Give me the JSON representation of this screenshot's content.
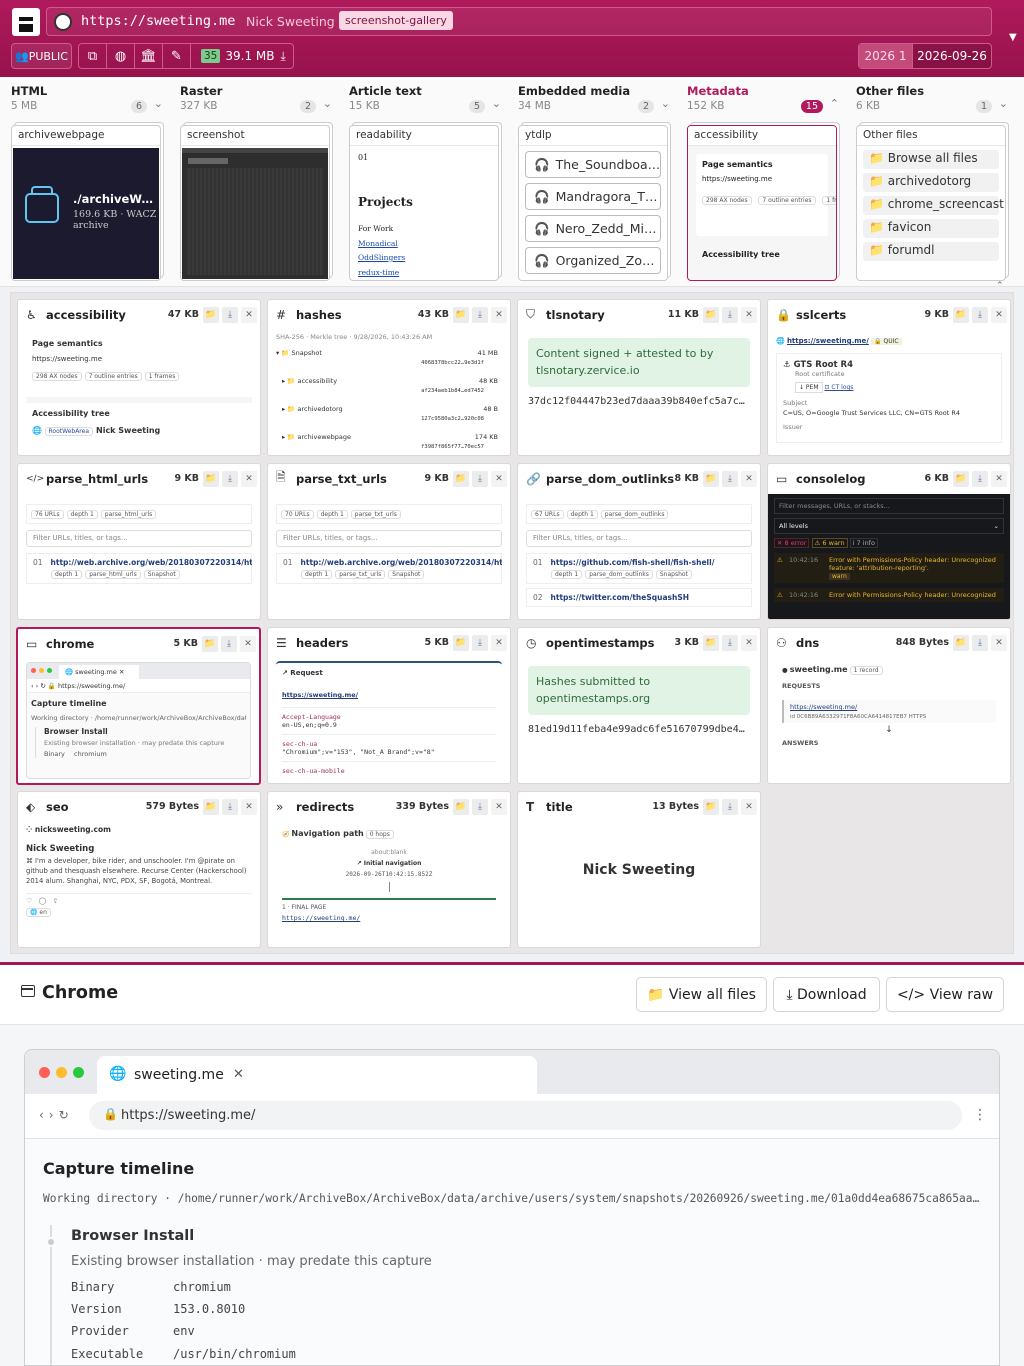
{
  "header": {
    "url": "https://sweeting.me",
    "title": "Nick Sweeting",
    "tag": "screenshot-gallery",
    "public_label": "👥PUBLIC",
    "result_count": "35",
    "total_size": "39.1 MB",
    "date_left": "2026 1",
    "date_right": "2026-09-26"
  },
  "categories": [
    {
      "title": "HTML",
      "size": "5 MB",
      "count": "6",
      "card_label": "archivewebpage",
      "card_text": "./archiveWebpage",
      "card_sub": "169.6 KB · WACZ",
      "card_sub2": "archive"
    },
    {
      "title": "Raster",
      "size": "327 KB",
      "count": "2",
      "card_label": "screenshot"
    },
    {
      "title": "Article text",
      "size": "15 KB",
      "count": "5",
      "card_label": "readability",
      "num": "01",
      "heading": "Projects",
      "sub": "For Work",
      "links": [
        "Monadical",
        "OddSlingers",
        "redux-time"
      ]
    },
    {
      "title": "Embedded media",
      "size": "34 MB",
      "count": "2",
      "card_label": "ytdlp",
      "items": [
        "The_Soundboa…",
        "Mandragora_T…",
        "Nero_Zedd_Mi…",
        "Organized_Zo…"
      ]
    },
    {
      "title": "Metadata",
      "size": "152 KB",
      "count": "15",
      "card_label": "accessibility",
      "sec1": "Page semantics",
      "url": "https://sweeting.me",
      "chip1": "298 AX nodes",
      "chip2": "7 outline entries",
      "chip3": "1 frames",
      "sec2": "Accessibility tree"
    },
    {
      "title": "Other files",
      "size": "6 KB",
      "count": "1",
      "card_label": "Other files",
      "items": [
        "Browse all files",
        "archivedotorg",
        "chrome_screencast",
        "favicon",
        "forumdl"
      ]
    }
  ],
  "cards": [
    {
      "name": "accessibility",
      "size": "47 KB",
      "icon": "♿"
    },
    {
      "name": "hashes",
      "size": "43 KB",
      "icon": "#"
    },
    {
      "name": "tlsnotary",
      "size": "11 KB",
      "icon": "⛉"
    },
    {
      "name": "sslcerts",
      "size": "9 KB",
      "icon": "🔒"
    },
    {
      "name": "parse_html_urls",
      "size": "9 KB",
      "icon": "</>"
    },
    {
      "name": "parse_txt_urls",
      "size": "9 KB",
      "icon": "🗎"
    },
    {
      "name": "parse_dom_outlinks",
      "size": "8 KB",
      "icon": "🔗"
    },
    {
      "name": "consolelog",
      "size": "6 KB",
      "icon": "▭"
    },
    {
      "name": "chrome",
      "size": "5 KB",
      "icon": "▭"
    },
    {
      "name": "headers",
      "size": "5 KB",
      "icon": "☰"
    },
    {
      "name": "opentimestamps",
      "size": "3 KB",
      "icon": "◷"
    },
    {
      "name": "dns",
      "size": "848 Bytes",
      "icon": "⚇"
    },
    {
      "name": "seo",
      "size": "579 Bytes",
      "icon": "⬖"
    },
    {
      "name": "redirects",
      "size": "339 Bytes",
      "icon": "»"
    },
    {
      "name": "title",
      "size": "13 Bytes",
      "icon": "T"
    }
  ],
  "card_content": {
    "accessibility": {
      "sec1": "Page semantics",
      "url": "https://sweeting.me",
      "chip1": "298 AX nodes",
      "chip2": "7 outline entries",
      "chip3": "1 frames",
      "sec2": "Accessibility tree",
      "role": "RootWebArea",
      "name": "Nick Sweeting"
    },
    "hashes": {
      "meta": "SHA-256 · Merkle tree · 9/28/2026, 10:43:26 AM",
      "rows": [
        {
          "name": "Snapshot",
          "size": "41 MB",
          "hash": "4068378bcc22…9e3d1f"
        },
        {
          "name": "accessibility",
          "size": "48 KB",
          "hash": "af234aeb1b84…ed7452"
        },
        {
          "name": "archivedotorg",
          "size": "48 B",
          "hash": "127c9580a3c2…920c08"
        },
        {
          "name": "archivewebpage",
          "size": "174 KB",
          "hash": "f3987f865f77…70ec57"
        }
      ]
    },
    "tlsnotary": {
      "text": "Content signed + attested to by tlsnotary.zervice.io",
      "hash": "37dc12f04447b23ed7daaa39b840efc5a7c…"
    },
    "sslcerts": {
      "host": "https://sweeting.me/",
      "proto": "QUIC",
      "cert": "GTS Root R4",
      "certsub": "Root certificate",
      "pem": "↓ PEM",
      "ctlogs": "CT logs",
      "subj_label": "Subject",
      "subject": "C=US, O=Google Trust Services LLC, CN=GTS Root R4",
      "issuer": "Issuer"
    },
    "parse_html_urls": {
      "chips": [
        "76 URLs",
        "depth 1",
        "parse_html_urls"
      ],
      "filter": "Filter URLs, titles, or tags...",
      "num": "01",
      "link": "http://web.archive.org/web/20180307220314/https://freevpn.club/",
      "tags": [
        "depth 1",
        "parse_html_urls",
        "Snapshot"
      ]
    },
    "parse_txt_urls": {
      "chips": [
        "70 URLs",
        "depth 1",
        "parse_txt_urls"
      ],
      "filter": "Filter URLs, titles, or tags...",
      "num": "01",
      "link": "http://web.archive.org/web/20180307220314/https://freevpn.club/",
      "tags": [
        "depth 1",
        "parse_txt_urls",
        "Snapshot"
      ]
    },
    "parse_dom_outlinks": {
      "chips": [
        "67 URLs",
        "depth 1",
        "parse_dom_outlinks"
      ],
      "filter": "Filter URLs, titles, or tags...",
      "num": "01",
      "link": "https://github.com/fish-shell/fish-shell/",
      "tags": [
        "depth 1",
        "parse_dom_outlinks",
        "Snapshot"
      ],
      "num2": "02",
      "link2": "https://twitter.com/theSquashSH"
    },
    "consolelog": {
      "filter": "Filter messages, URLs, or stacks...",
      "levels": "All levels",
      "c_err": "✕ 8 error",
      "c_warn": "⚠ 6 warn",
      "c_info": "i 7 info",
      "time": "10:42:16",
      "msg": "Error with Permissions-Policy header: Unrecognized feature: 'attribution-reporting'.",
      "lvl": "warn",
      "msg2": "Error with Permissions-Policy header: Unrecognized"
    },
    "chrome": {
      "tab": "sweeting.me",
      "url": "https://sweeting.me/",
      "h": "Capture timeline",
      "wd": "Working directory · /home/runner/work/ArchiveBox/ArchiveBox/dat…",
      "bi": "Browser Install",
      "bs": "Existing browser installation · may predate this capture",
      "bin": "Binary",
      "binv": "chromium"
    },
    "headers": {
      "sec": "↗ Request",
      "url": "https://sweeting.me/",
      "k1": "Accept-Language",
      "v1": "en-US,en;q=0.9",
      "k2": "sec-ch-ua",
      "v2": "\"Chromium\";v=\"153\", \"Not_A Brand\";v=\"8\"",
      "k3": "sec-ch-ua-mobile"
    },
    "opentimestamps": {
      "text": "Hashes submitted to opentimestamps.org",
      "hash": "81ed19d11feba4e99adc6fe51670799dbe4…"
    },
    "dns": {
      "host": "sweeting.me",
      "rec": "1 record",
      "req": "REQUESTS",
      "link": "https://sweeting.me/",
      "id": "id 0C6B89A6332971F8A60CA6414817EB7 HTTPS",
      "arrow": "↓",
      "ans": "ANSWERS"
    },
    "seo": {
      "site": "nicksweeting.com",
      "title": "Nick Sweeting",
      "desc": "⌘ I'm a developer, bike rider, and unschooler. I'm @pirate on github and thesquash elsewhere. Recurse Center (Hackerschool) 2014 alum. Shanghai, NYC, PDX, SF, Bogotá, Montreal.",
      "lang": "en"
    },
    "redirects": {
      "title": "Navigation path",
      "hops": "0 hops",
      "blank": "about:blank",
      "init": "↗ Initial navigation",
      "ts": "2026-09-26T10:42:15.852Z",
      "final": "1 · FINAL PAGE",
      "url": "https://sweeting.me/"
    },
    "title": {
      "value": "Nick Sweeting"
    }
  },
  "panel": {
    "title": "Chrome",
    "btn_files": "📁 View all files",
    "btn_download": "⤓ Download",
    "btn_raw": "</> View raw",
    "tab_title": "sweeting.me",
    "url": "https://sweeting.me/",
    "cap_title": "Capture timeline",
    "workdir": "Working directory · /home/runner/work/ArchiveBox/ArchiveBox/data/archive/users/system/snapshots/20260926/sweeting.me/01a0dd4ea68675ca865aa0f…",
    "install_title": "Browser Install",
    "install_sub": "Existing browser installation · may predate this capture",
    "kv": [
      {
        "k": "Binary",
        "v": "chromium"
      },
      {
        "k": "Version",
        "v": "153.0.8010"
      },
      {
        "k": "Provider",
        "v": "env"
      },
      {
        "k": "Executable",
        "v": "/usr/bin/chromium"
      }
    ]
  }
}
